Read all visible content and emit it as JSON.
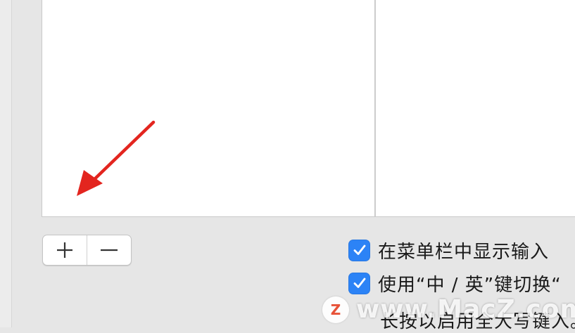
{
  "list_controls": {
    "add_label": "+",
    "remove_label": "−"
  },
  "options": [
    {
      "label": "在菜单栏中显示输入",
      "checked": true
    },
    {
      "label": "使用“中 / 英”键切换“",
      "checked": true
    }
  ],
  "partial_text": "长按以启用全大写键入。",
  "watermark": {
    "logo_letter": "Z",
    "text": "www.MacZ.com"
  },
  "colors": {
    "checkbox": "#2c83f6",
    "arrow": "#e3251f",
    "watermark_logo": "#e8462a"
  }
}
